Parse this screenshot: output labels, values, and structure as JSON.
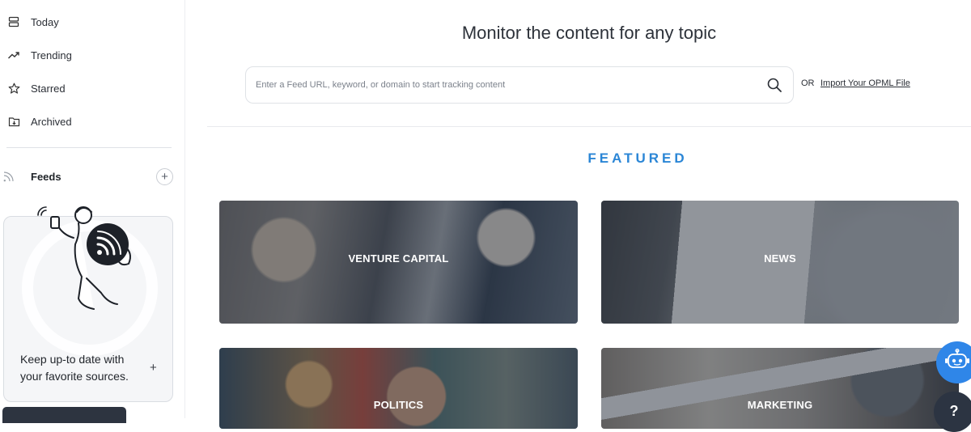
{
  "sidebar": {
    "items": [
      {
        "label": "Today",
        "icon": "stack-icon"
      },
      {
        "label": "Trending",
        "icon": "trending-icon"
      },
      {
        "label": "Starred",
        "icon": "star-icon"
      },
      {
        "label": "Archived",
        "icon": "archive-icon"
      }
    ],
    "feeds_label": "Feeds",
    "add_feed": "+",
    "promo": {
      "text": "Keep up-to date with your favorite sources.",
      "plus": "+"
    }
  },
  "main": {
    "title": "Monitor the content for any topic",
    "search": {
      "placeholder": "Enter a Feed URL, keyword, or domain to start tracking content",
      "value": ""
    },
    "or_text": "OR",
    "import_link": "Import Your OPML File",
    "featured_heading": "FEATURED",
    "cards": [
      {
        "label": "VENTURE CAPITAL"
      },
      {
        "label": "NEWS"
      },
      {
        "label": "POLITICS"
      },
      {
        "label": "MARKETING"
      }
    ]
  },
  "help_button": "?",
  "colors": {
    "accent": "#2b86d6",
    "bot_button": "#2f86e8",
    "help_button": "#2c3442"
  }
}
